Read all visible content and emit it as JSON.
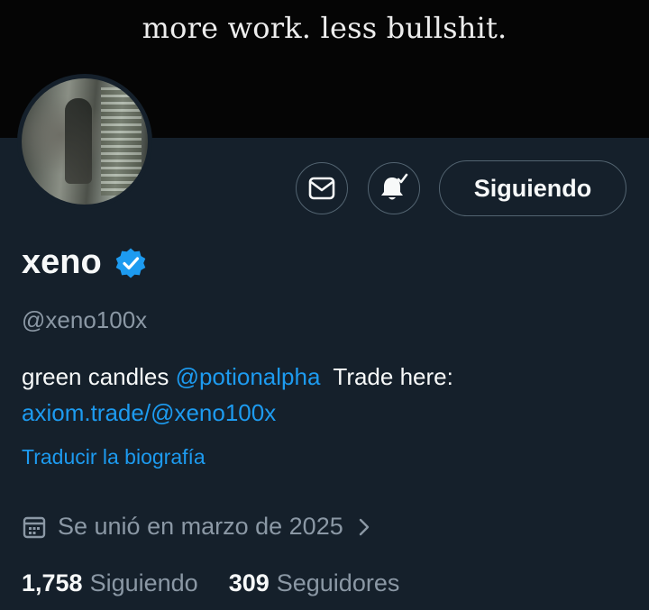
{
  "banner": {
    "text": "more work. less bullshit."
  },
  "actions": {
    "mail_icon": "envelope-icon",
    "bell_icon": "bell-check-icon",
    "follow_label": "Siguiendo"
  },
  "profile": {
    "name": "xeno",
    "verified_icon": "verified-badge-icon",
    "handle": "@xeno100x",
    "bio": {
      "text1": "green candles ",
      "mention": "@potionalpha",
      "text2": "  Trade here: ",
      "link": "axiom.trade/@xeno100x"
    },
    "translate": "Traducir la biografía",
    "joined": "Se unió en marzo de 2025"
  },
  "stats": {
    "following_count": "1,758",
    "following_label": "Siguiendo",
    "followers_count": "309",
    "followers_label": "Seguidores"
  },
  "colors": {
    "background": "#15202b",
    "accent": "#1d9bf0",
    "secondary_text": "#8b98a5",
    "border": "#536471"
  }
}
